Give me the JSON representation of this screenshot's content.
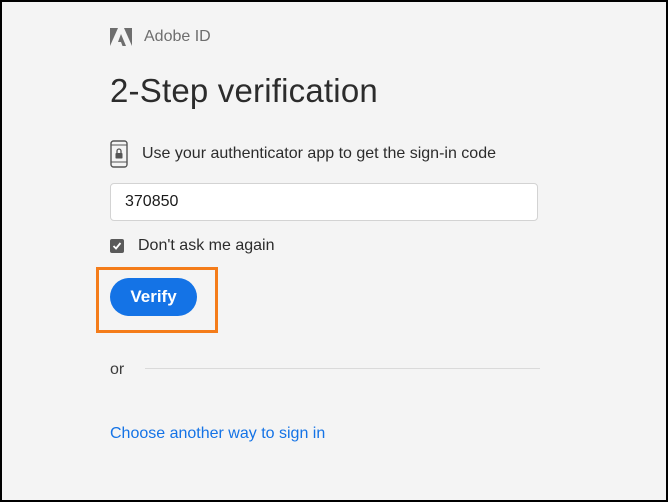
{
  "brand": {
    "name": "Adobe ID",
    "logo_icon": "adobe-logo-icon"
  },
  "title": "2-Step verification",
  "auth": {
    "icon": "phone-lock-icon",
    "text": "Use your authenticator app to get the sign-in code"
  },
  "code_input": {
    "value": "370850"
  },
  "remember": {
    "checked": true,
    "label": "Don't ask me again"
  },
  "verify_button": {
    "label": "Verify"
  },
  "separator": {
    "text": "or"
  },
  "alt_link": {
    "label": "Choose another way to sign in"
  },
  "colors": {
    "accent": "#1473e6",
    "highlight": "#f47c1a",
    "background": "#f4f4f4"
  }
}
